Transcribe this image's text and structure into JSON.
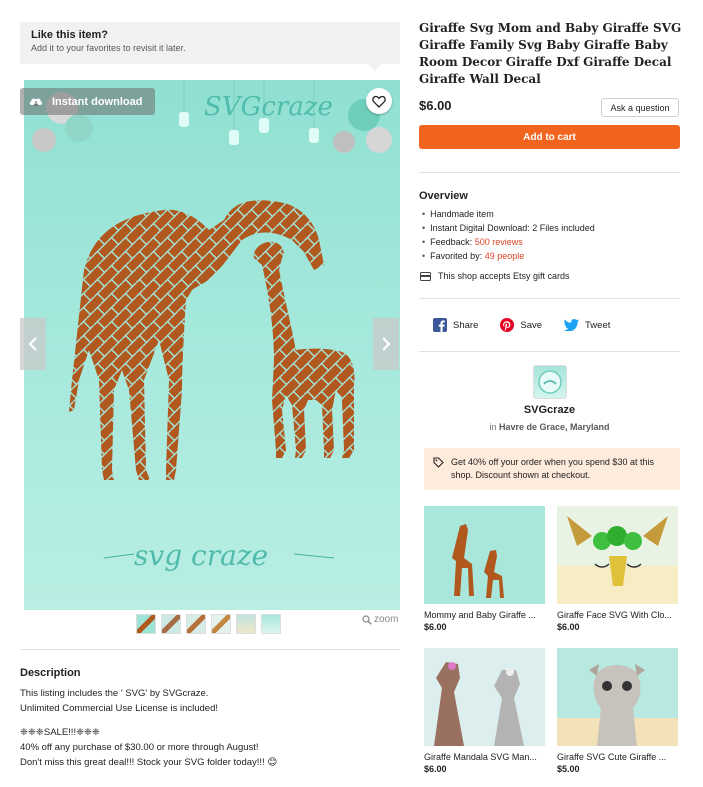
{
  "favorite_banner": {
    "title": "Like this item?",
    "subtitle": "Add it to your favorites to revisit it later."
  },
  "gallery": {
    "badge_label": "Instant download",
    "watermark_top": "SVGcraze",
    "watermark_bottom": "svg craze",
    "zoom_label": "zoom",
    "thumbnail_count": 6
  },
  "description": {
    "title": "Description",
    "lines": [
      "This listing includes the ' SVG' by SVGcraze.",
      "Unlimited Commercial Use License is included!",
      "",
      "❈❈❈SALE!!!❈❈❈",
      "40% off any purchase of $30.00 or more through August!",
      "Don't miss this great deal!!! Stock your SVG folder today!!! 😊"
    ]
  },
  "listing": {
    "title": "Giraffe Svg Mom and Baby Giraffe SVG Giraffe Family Svg Baby Giraffe Baby Room Decor Giraffe Dxf Giraffe Decal Giraffe Wall Decal",
    "price": "$6.00",
    "ask_label": "Ask a question",
    "cart_label": "Add to cart"
  },
  "overview": {
    "title": "Overview",
    "items": {
      "handmade": "Handmade item",
      "download": "Instant Digital Download: 2 Files included",
      "feedback_label": "Feedback: ",
      "feedback_link": "500 reviews",
      "favorited_label": "Favorited by: ",
      "favorited_link": "49 people"
    },
    "giftcard": "This shop accepts Etsy gift cards"
  },
  "share": {
    "facebook": "Share",
    "pinterest": "Save",
    "twitter": "Tweet"
  },
  "shop": {
    "name": "SVGcraze",
    "location_prefix": "in",
    "location": "Havre de Grace, Maryland"
  },
  "promo": {
    "text": "Get 40% off your order when you spend $30 at this shop. Discount shown at checkout."
  },
  "related": [
    {
      "title": "Mommy and Baby Giraffe ...",
      "price": "$6.00"
    },
    {
      "title": "Giraffe Face SVG With Clo...",
      "price": "$6.00"
    },
    {
      "title": "Giraffe Mandala SVG Man...",
      "price": "$6.00"
    },
    {
      "title": "Giraffe SVG Cute Giraffe ...",
      "price": "$5.00"
    }
  ],
  "colors": {
    "accent": "#f1641e",
    "link": "#d9452b",
    "image_bg": "#a4e8dc",
    "giraffe": "#b0581d",
    "promo_bg": "#fdebdc"
  }
}
